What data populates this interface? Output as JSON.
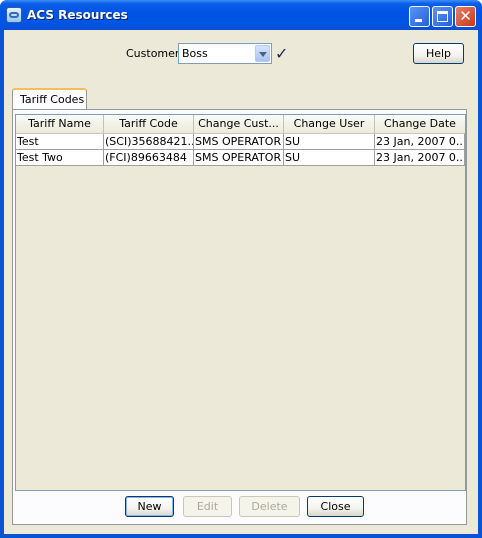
{
  "window": {
    "title": "ACS Resources"
  },
  "customer": {
    "label": "Customer",
    "value": "Boss"
  },
  "buttons": {
    "help": "Help",
    "new": "New",
    "edit": "Edit",
    "delete": "Delete",
    "close": "Close"
  },
  "tabs": [
    {
      "label": "Tariff Codes",
      "selected": true
    }
  ],
  "table": {
    "columns": [
      "Tariff Name",
      "Tariff Code",
      "Change Cust...",
      "Change User",
      "Change Date"
    ],
    "rows": [
      [
        "Test",
        "(SCI)35688421...",
        "SMS OPERATOR",
        "SU",
        "23 Jan, 2007 0..."
      ],
      [
        "Test Two",
        "(FCI)89663484",
        "SMS OPERATOR",
        "SU",
        "23 Jan, 2007 0..."
      ]
    ]
  },
  "icons": {
    "app": "acs-app-icon",
    "check": "checkmark-icon",
    "minimize": "minimize-icon",
    "maximize": "maximize-icon",
    "close": "close-icon",
    "dropdown": "chevron-down-icon"
  },
  "colors": {
    "titlebar": "#0054e3",
    "dialog_bg": "#ece9d8",
    "tab_highlight": "#f7bd5a"
  }
}
